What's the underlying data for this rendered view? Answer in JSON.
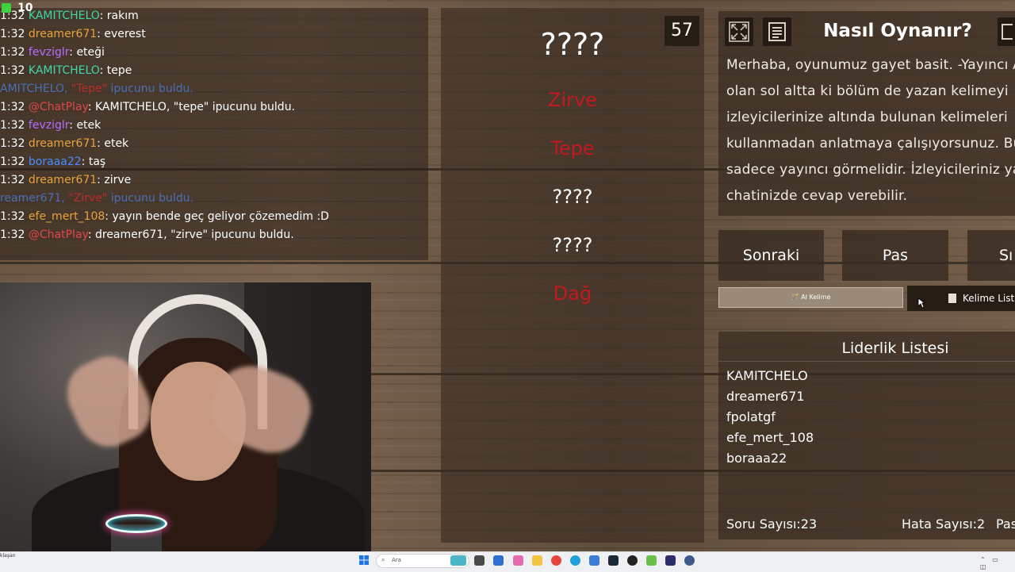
{
  "overlay": {
    "viewer_count": "10"
  },
  "chat": {
    "messages": [
      {
        "time": "1:32",
        "user": "KAMITCHELO",
        "color": "#3fd6a8",
        "text": "rakım"
      },
      {
        "time": "1:32",
        "user": "dreamer671",
        "color": "#e8a23a",
        "text": "everest"
      },
      {
        "time": "1:32",
        "user": "fevziglr",
        "color": "#b86bff",
        "text": "eteği"
      },
      {
        "time": "1:32",
        "user": "KAMITCHELO",
        "color": "#3fd6a8",
        "text": "tepe"
      },
      {
        "time": "",
        "user": "AMITCHELO,",
        "color": "#4a7dd8",
        "text": "ipucunu buldu.",
        "hint": "\"Tepe\""
      },
      {
        "time": "1:32",
        "user": "@ChatPlay",
        "color": "#e04848",
        "text": "KAMITCHELO, \"tepe\" ipucunu buldu."
      },
      {
        "time": "1:32",
        "user": "fevziglr",
        "color": "#b86bff",
        "text": "etek"
      },
      {
        "time": "1:32",
        "user": "dreamer671",
        "color": "#e8a23a",
        "text": "etek"
      },
      {
        "time": "1:32",
        "user": "boraaa22",
        "color": "#4a8cff",
        "text": "taş"
      },
      {
        "time": "1:32",
        "user": "dreamer671",
        "color": "#e8a23a",
        "text": "zirve"
      },
      {
        "time": "",
        "user": "reamer671,",
        "color": "#4a7dd8",
        "text": "ipucunu buldu.",
        "hint": "\"Zirve\""
      },
      {
        "time": "1:32",
        "user": "efe_mert_108",
        "color": "#e8a23a",
        "text": "yayın bende geç geliyor çözemedim :D"
      },
      {
        "time": "1:32",
        "user": "@ChatPlay",
        "color": "#e04848",
        "text": "dreamer671, \"zirve\" ipucunu buldu."
      }
    ]
  },
  "game": {
    "counter": "57",
    "main_word": "????",
    "hints": [
      {
        "text": "Zirve",
        "state": "guessed"
      },
      {
        "text": "Tepe",
        "state": "guessed"
      },
      {
        "text": "????",
        "state": "hidden"
      },
      {
        "text": "????",
        "state": "hidden"
      },
      {
        "text": "Dağ",
        "state": "guessed"
      }
    ],
    "guessed_color": "#c3191f"
  },
  "howto": {
    "title": "Nasıl Oynanır?",
    "lines": [
      "Merhaba, oyunumuz gayet basit. -Yayıncı A",
      "olan sol altta ki bölüm de yazan kelimeyi",
      "izleyicilerinize altında bulunan kelimeleri",
      "kullanmadan anlatmaya çalışıyorsunuz. Bu",
      "sadece yayıncı görmelidir. İzleyicileriniz yay",
      "chatinizde cevap verebilir."
    ]
  },
  "actions": {
    "next": "Sonraki",
    "pass": "Pas",
    "third": "Sı",
    "ai_word": "🪄 AI Kelime",
    "word_list": "Kelime List"
  },
  "leaderboard": {
    "title": "Liderlik Listesi",
    "entries": [
      "KAMITCHELO",
      "dreamer671",
      "fpolatgf",
      "efe_mert_108",
      "boraaa22"
    ],
    "question_count": "Soru Sayısı:23",
    "error_count": "Hata Sayısı:2",
    "pass_count": "Pas"
  },
  "taskbar": {
    "left_text": "klaşan",
    "search_placeholder": "Ara"
  }
}
